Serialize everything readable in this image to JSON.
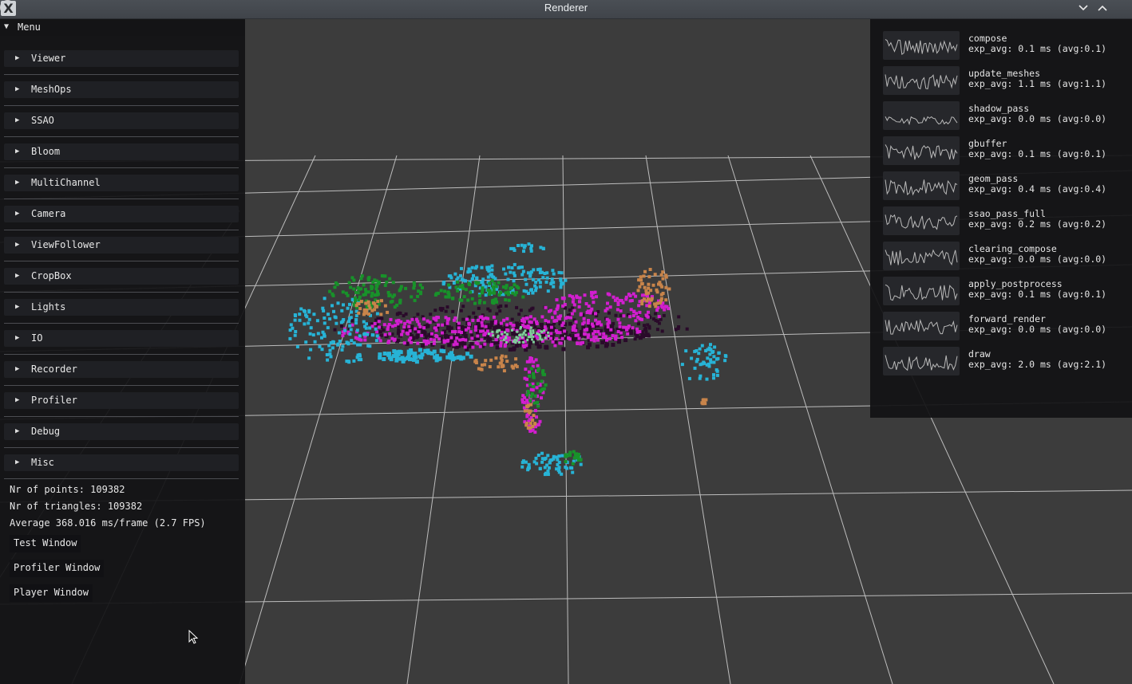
{
  "window": {
    "title": "Renderer",
    "logo": "X"
  },
  "menu": {
    "header": "Menu",
    "sections": [
      {
        "label": "Viewer"
      },
      {
        "label": "MeshOps"
      },
      {
        "label": "SSAO"
      },
      {
        "label": "Bloom"
      },
      {
        "label": "MultiChannel"
      },
      {
        "label": "Camera"
      },
      {
        "label": "ViewFollower"
      },
      {
        "label": "CropBox"
      },
      {
        "label": "Lights"
      },
      {
        "label": "IO"
      },
      {
        "label": "Recorder"
      },
      {
        "label": "Profiler"
      },
      {
        "label": "Debug"
      },
      {
        "label": "Misc"
      }
    ],
    "stats": {
      "points": "Nr of points: 109382",
      "triangles": "Nr of triangles: 109382",
      "average": "Average 368.016 ms/frame (2.7 FPS)"
    },
    "buttons": {
      "test_window": "Test Window",
      "profiler_window": "Profiler Window",
      "player_window": "Player Window"
    }
  },
  "profiler": {
    "entries": [
      {
        "name": "compose",
        "value": "exp_avg: 0.1 ms (avg:0.1)"
      },
      {
        "name": "update_meshes",
        "value": "exp_avg: 1.1 ms (avg:1.1)"
      },
      {
        "name": "shadow_pass",
        "value": "exp_avg: 0.0 ms (avg:0.0)"
      },
      {
        "name": "gbuffer",
        "value": "exp_avg: 0.1 ms (avg:0.1)"
      },
      {
        "name": "geom_pass",
        "value": "exp_avg: 0.4 ms (avg:0.4)"
      },
      {
        "name": "ssao_pass_full",
        "value": "exp_avg: 0.2 ms (avg:0.2)"
      },
      {
        "name": "clearing_compose",
        "value": "exp_avg: 0.0 ms (avg:0.0)"
      },
      {
        "name": "apply_postprocess",
        "value": "exp_avg: 0.1 ms (avg:0.1)"
      },
      {
        "name": "forward_render",
        "value": "exp_avg: 0.0 ms (avg:0.0)"
      },
      {
        "name": "draw",
        "value": "exp_avg: 2.0 ms (avg:2.1)"
      }
    ]
  },
  "icons": {
    "collapse": "triangle-down-icon",
    "expand": "triangle-right-icon",
    "minimize": "chevron-down-icon",
    "maximize": "chevron-up-icon",
    "close": "close-icon"
  },
  "colors": {
    "point_magenta": "#d21ecf",
    "point_cyan": "#27b3d6",
    "point_green": "#18922a",
    "point_orange": "#c8844a",
    "point_dark": "#2a0a2a",
    "grid": "#bdbdbd"
  }
}
